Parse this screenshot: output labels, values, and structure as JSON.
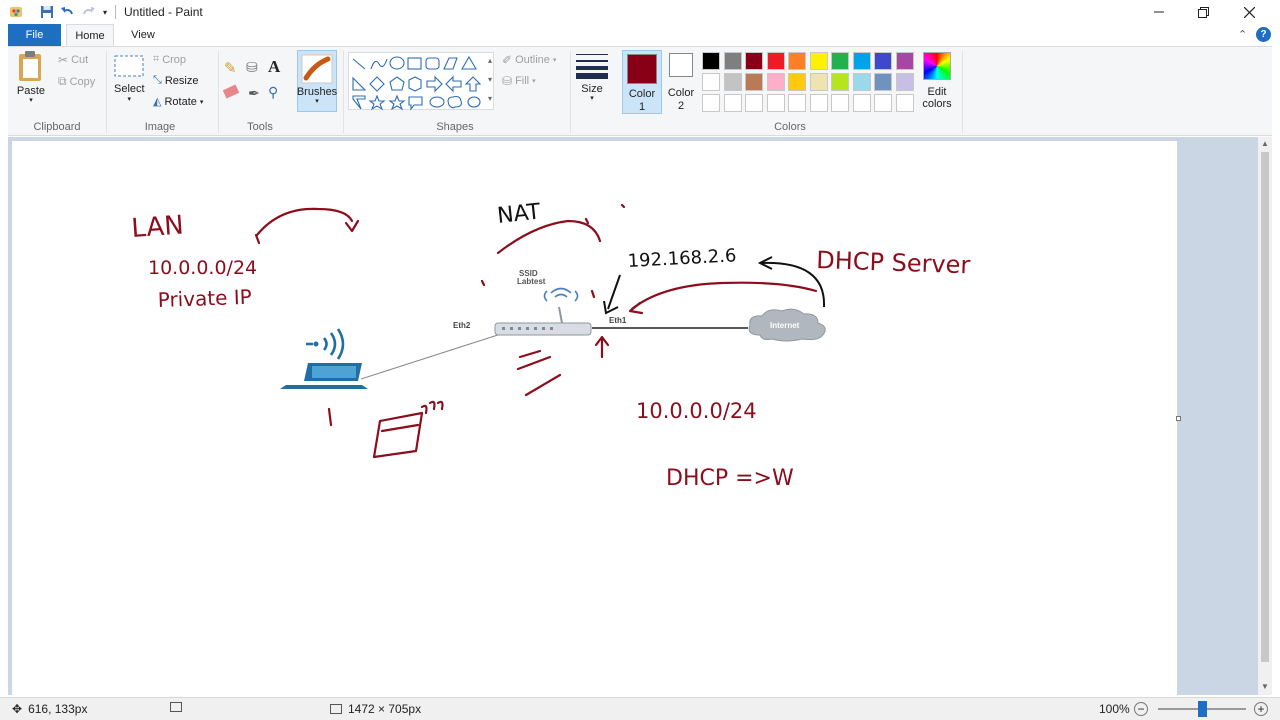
{
  "window": {
    "title": "Untitled - Paint"
  },
  "tabs": {
    "file": "File",
    "home": "Home",
    "view": "View"
  },
  "ribbon": {
    "clipboard": {
      "paste": "Paste",
      "cut": "Cut",
      "copy": "Copy",
      "label": "Clipboard"
    },
    "image": {
      "select": "Select",
      "crop": "Crop",
      "resize": "Resize",
      "rotate": "Rotate",
      "label": "Image"
    },
    "tools": {
      "label": "Tools"
    },
    "brushes": {
      "label": "Brushes"
    },
    "shapes": {
      "outline": "Outline",
      "fill": "Fill",
      "label": "Shapes"
    },
    "size": {
      "label": "Size"
    },
    "color1": {
      "label": "Color",
      "sub": "1",
      "value": "#880015"
    },
    "color2": {
      "label": "Color",
      "sub": "2",
      "value": "#ffffff"
    },
    "colors": {
      "label": "Colors",
      "edit": "Edit colors",
      "row1": [
        "#000000",
        "#7f7f7f",
        "#880015",
        "#ed1c24",
        "#ff7f27",
        "#fff200",
        "#22b14c",
        "#00a2e8",
        "#3f48cc",
        "#a349a4"
      ],
      "row2": [
        "#ffffff",
        "#c3c3c3",
        "#b97a57",
        "#ffaec9",
        "#ffc90e",
        "#efe4b0",
        "#b5e61d",
        "#99d9ea",
        "#7092be",
        "#c8bfe7"
      ]
    }
  },
  "drawing": {
    "ssid": "SSID",
    "ssid_name": "Labtest",
    "eth2": "Eth2",
    "eth1": "Eth1",
    "internet": "Internet",
    "lan": "LAN",
    "lan_net": "10.0.0.0/24",
    "private_ip": "Private IP",
    "nat": "NAT",
    "wan_ip": "192.168.2.6",
    "dhcp_server": "DHCP Server",
    "lan_net2": "10.0.0.0/24",
    "dhcp_note": "DHCP =>W"
  },
  "status": {
    "cursor": "616, 133px",
    "canvas_size": "1472 × 705px",
    "zoom": "100%",
    "zoom_level": 100
  }
}
